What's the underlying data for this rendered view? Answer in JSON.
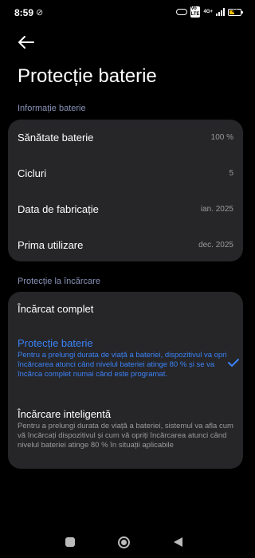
{
  "status_bar": {
    "time": "8:59",
    "network": "4G+",
    "battery_level": "44",
    "battery_fill_fraction": 0.44,
    "battery_color": "#f0c000"
  },
  "header": {
    "title": "Protecție baterie",
    "back_icon": "arrow-left-icon"
  },
  "battery_info": {
    "section_label": "Informație baterie",
    "rows": [
      {
        "label": "Sănătate baterie",
        "value": "100 %"
      },
      {
        "label": "Cicluri",
        "value": "5"
      },
      {
        "label": "Data de fabricație",
        "value": "ian. 2025"
      },
      {
        "label": "Prima utilizare",
        "value": "dec. 2025"
      }
    ]
  },
  "charging_protection": {
    "section_label": "Protecție la încărcare",
    "options": [
      {
        "title": "Încărcat complet",
        "description": "",
        "selected": false
      },
      {
        "title": "Protecție baterie",
        "description": "Pentru a prelungi durata de viață a bateriei, dispozitivul va opri încărcarea atunci când nivelul bateriei atinge 80 % și se va încărca complet numai când este programat.",
        "selected": true
      },
      {
        "title": "Încărcare inteligentă",
        "description": "Pentru a prelungi durata de viață a bateriei, sistemul va afla cum vă încărcați dispozitivul și cum vă opriți încărcarea atunci când nivelul bateriei atinge 80 % în situații aplicabile",
        "selected": false
      }
    ],
    "accent_color": "#3b82f6"
  }
}
